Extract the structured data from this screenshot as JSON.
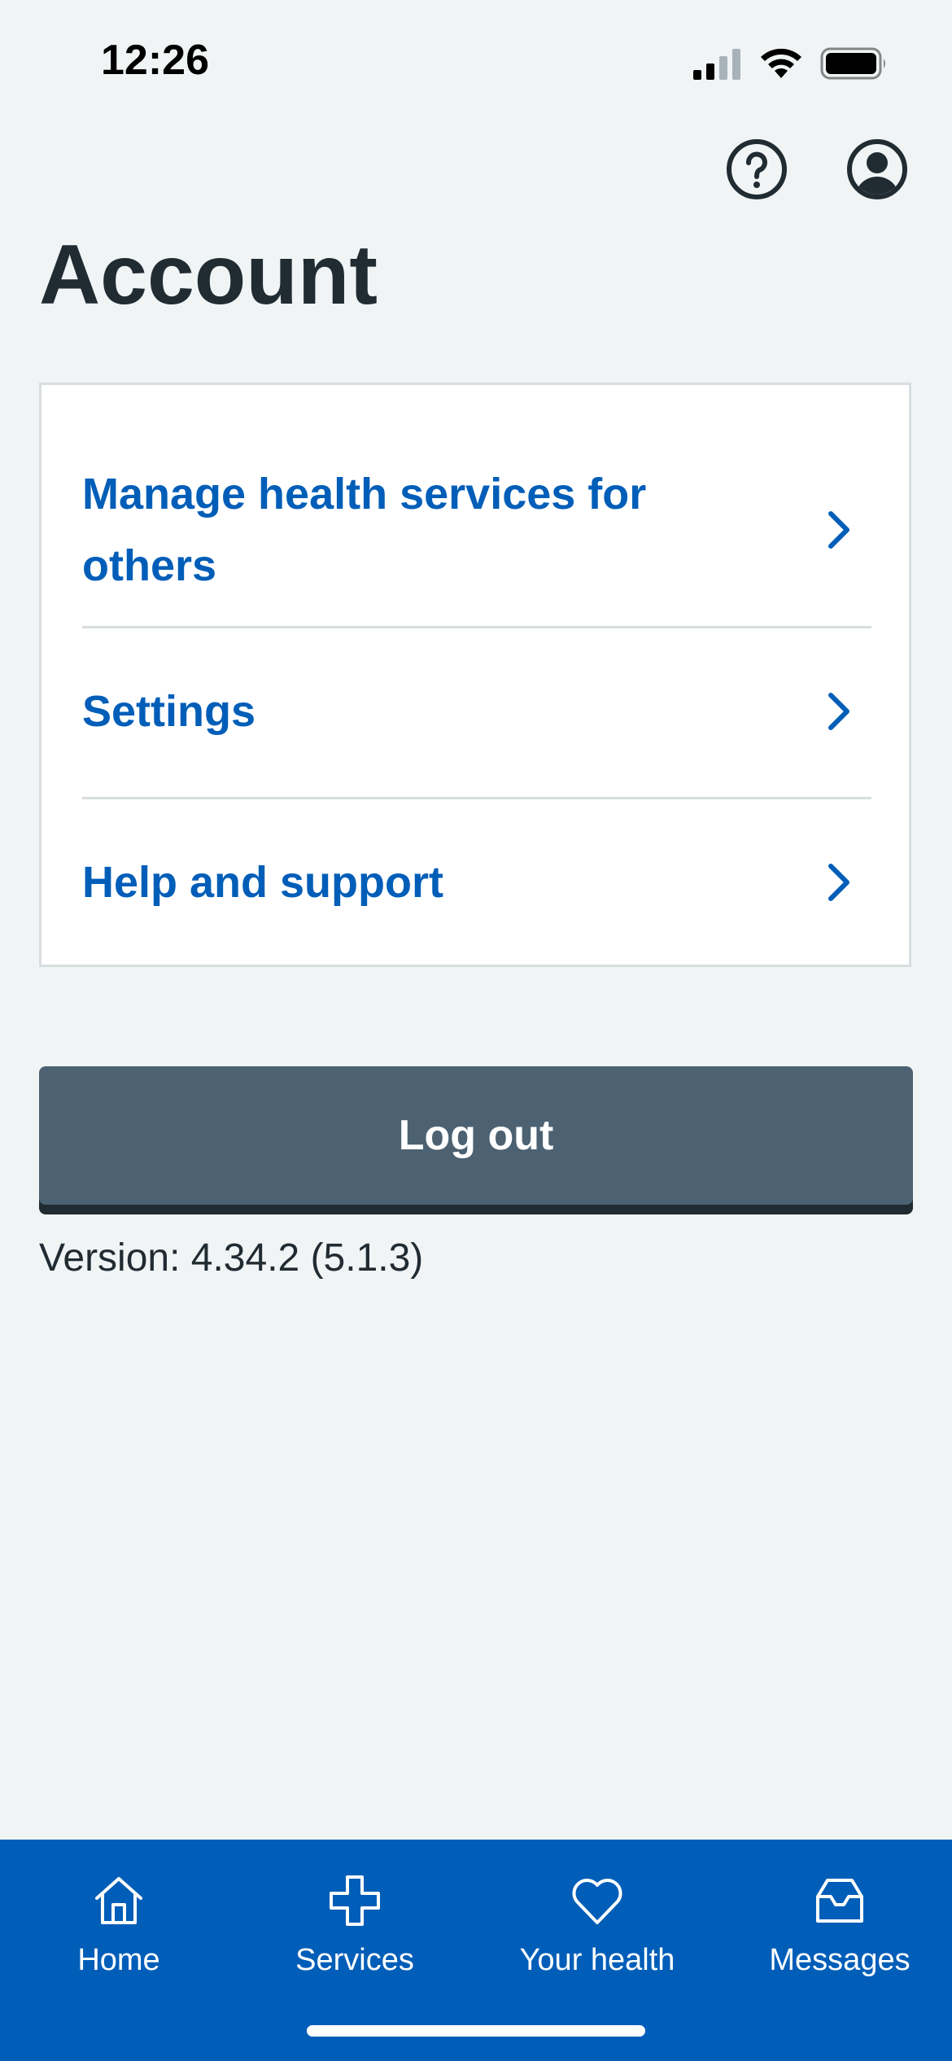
{
  "status_bar": {
    "time": "12:26"
  },
  "header": {
    "help_icon": "help-question-icon",
    "profile_icon": "user-profile-icon",
    "title": "Account"
  },
  "menu": {
    "items": [
      {
        "label": "Manage health services for others",
        "icon": "chevron-right-icon"
      },
      {
        "label": "Settings",
        "icon": "chevron-right-icon"
      },
      {
        "label": "Help and support",
        "icon": "chevron-right-icon"
      }
    ]
  },
  "logout": {
    "label": "Log out"
  },
  "version": {
    "text": "Version: 4.34.2 (5.1.3)"
  },
  "bottom_nav": {
    "items": [
      {
        "label": "Home",
        "icon": "home-icon"
      },
      {
        "label": "Services",
        "icon": "plus-cross-icon"
      },
      {
        "label": "Your health",
        "icon": "heart-icon"
      },
      {
        "label": "Messages",
        "icon": "inbox-icon"
      }
    ]
  },
  "colors": {
    "background": "#f0f4f5",
    "link_blue": "#005eb8",
    "text_dark": "#212b32",
    "button_grey": "#4c6272",
    "nav_blue": "#005eb8",
    "card_border": "#d8dde0"
  }
}
